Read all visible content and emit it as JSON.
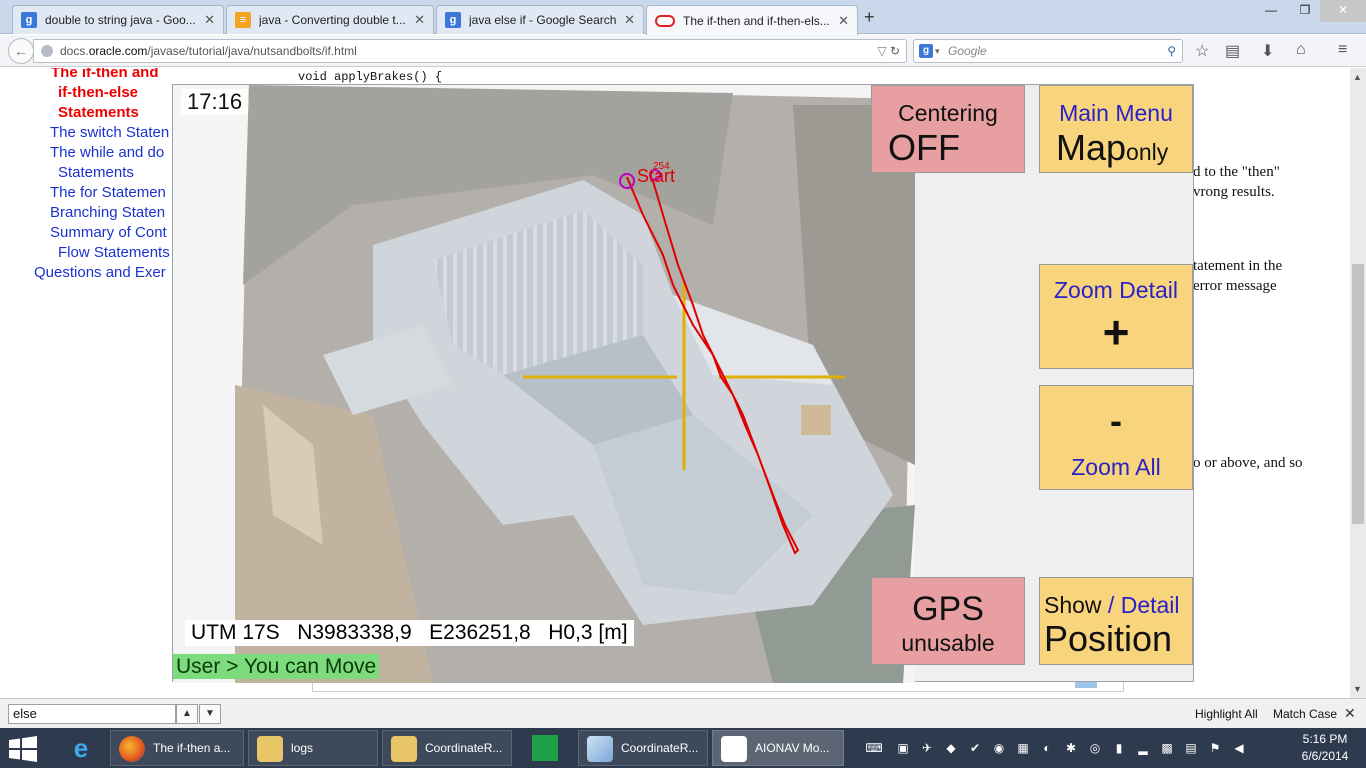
{
  "browser": {
    "tabs": [
      {
        "label": "double to string java - Goo...",
        "icon": "google-icon",
        "active": false
      },
      {
        "label": "java - Converting double t...",
        "icon": "stackoverflow-icon",
        "active": false
      },
      {
        "label": "java else if - Google Search",
        "icon": "google-icon",
        "active": false
      },
      {
        "label": "The if-then and if-then-els...",
        "icon": "oracle-icon",
        "active": true
      }
    ],
    "new_tab": "+",
    "url_prefix": "docs.",
    "url_domain": "oracle.com",
    "url_path": "/javase/tutorial/java/nutsandbolts/if.html",
    "search_placeholder": "Google",
    "search_engine_glyph": "g"
  },
  "page": {
    "toc": [
      {
        "label": "The if-then and",
        "current": true
      },
      {
        "label": "if-then-else",
        "current": true
      },
      {
        "label": "Statements",
        "current": true
      },
      {
        "label": "The switch Staten",
        "current": false
      },
      {
        "label": "The while and do",
        "current": false
      },
      {
        "label": "Statements",
        "current": false
      },
      {
        "label": "The for Statemen",
        "current": false
      },
      {
        "label": "Branching Staten",
        "current": false
      },
      {
        "label": "Summary of Cont",
        "current": false
      },
      {
        "label": "Flow Statements",
        "current": false
      },
      {
        "label": "Questions and Exer",
        "current": false
      }
    ],
    "code_line": "void applyBrakes() {",
    "article_fragments": [
      "d to the \"then\"",
      "vrong results.",
      "tatement in the",
      " error message",
      "o or above, and so"
    ]
  },
  "app": {
    "clock": "17:16",
    "utm_readout": "UTM 17S   N3983338,9   E236251,8   H0,3 [m]",
    "user_status": "User > You can Move",
    "start_label": "Start",
    "start_number": "254",
    "buttons": {
      "centering": {
        "line1": "Centering",
        "line2": "OFF"
      },
      "main_menu": {
        "line1": "Main Menu",
        "line2_big": "Map",
        "line2_small": "only"
      },
      "zoom_detail": {
        "line1": "Zoom Detail",
        "line2": "+"
      },
      "zoom_all": {
        "line1": "-",
        "line2": "Zoom All"
      },
      "gps": {
        "line1": "GPS",
        "line2": "unusable"
      },
      "show_position": {
        "line1a": "Show",
        "line1b": " / Detail",
        "line2": "Position"
      }
    },
    "colors": {
      "pink_button": "#e89fa1",
      "yellow_button": "#f8d57c",
      "blue_text": "#2a22c8",
      "status_green": "#7ddb7d",
      "track_red": "#e00000",
      "crosshair": "#e0b000"
    }
  },
  "findbar": {
    "query": "else",
    "highlight_all": "Highlight All",
    "match_case": "Match Case"
  },
  "taskbar": {
    "items": [
      {
        "label": "The if-then a...",
        "icon": "firefox-icon"
      },
      {
        "label": "logs",
        "icon": "folder-icon"
      },
      {
        "label": "CoordinateR...",
        "icon": "folder-icon"
      },
      {
        "label": "CoordinateR...",
        "icon": "cube-app-icon"
      },
      {
        "label": "AIONAV Mo...",
        "icon": "aionav-icon"
      }
    ],
    "time": "5:16 PM",
    "date": "6/6/2014"
  }
}
